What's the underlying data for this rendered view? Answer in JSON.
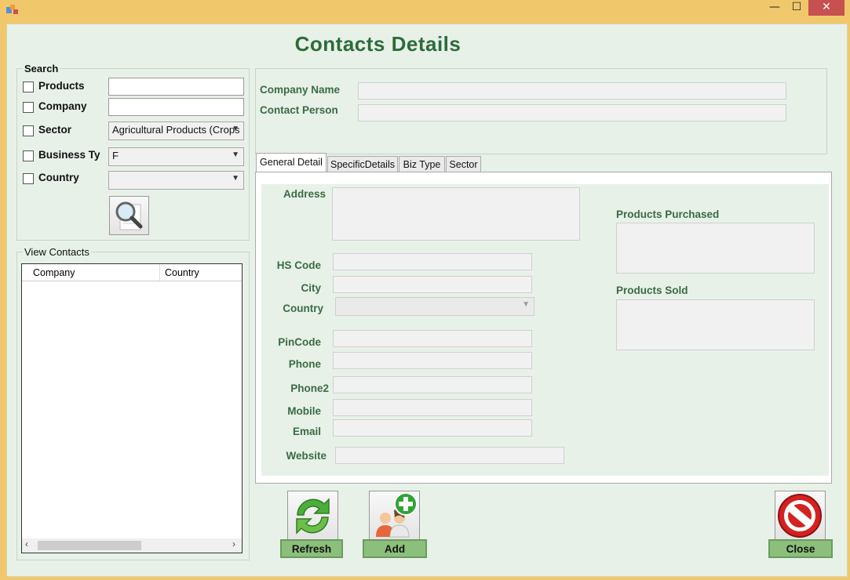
{
  "window": {
    "title_controls": {
      "minimize": "—",
      "maximize": "☐",
      "close": "✕"
    }
  },
  "header": {
    "title": "Contacts  Details"
  },
  "search": {
    "legend": "Search",
    "products_label": "Products",
    "company_label": "Company",
    "sector_label": "Sector",
    "sector_value": "Agricultural Products (Crops",
    "business_type_label": "Business Ty",
    "business_type_value": "F",
    "country_label": "Country",
    "country_value": "",
    "search_icon": "magnifier-icon"
  },
  "view_contacts": {
    "legend": "View Contacts",
    "columns": [
      "Company",
      "Country"
    ],
    "rows": []
  },
  "company": {
    "company_name_label": "Company Name",
    "contact_person_label": "Contact Person",
    "company_name_value": "",
    "contact_person_value": ""
  },
  "tabs": [
    "General Detail",
    "SpecificDetails",
    "Biz Type",
    "Sector"
  ],
  "general": {
    "address_label": "Address",
    "hs_code_label": "HS Code",
    "city_label": "City",
    "country_label": "Country",
    "pincode_label": "PinCode",
    "phone_label": "Phone",
    "phone2_label": "Phone2",
    "mobile_label": "Mobile",
    "email_label": "Email",
    "website_label": "Website",
    "products_purchased_label": "Products Purchased",
    "products_sold_label": "Products Sold"
  },
  "actions": {
    "refresh_label": "Refresh",
    "add_label": "Add",
    "close_label": "Close"
  },
  "colors": {
    "accent": "#2e6b3b",
    "label_green": "#3a6b44",
    "button_green": "#8bbf7b",
    "titlebar": "#f0c86b"
  }
}
